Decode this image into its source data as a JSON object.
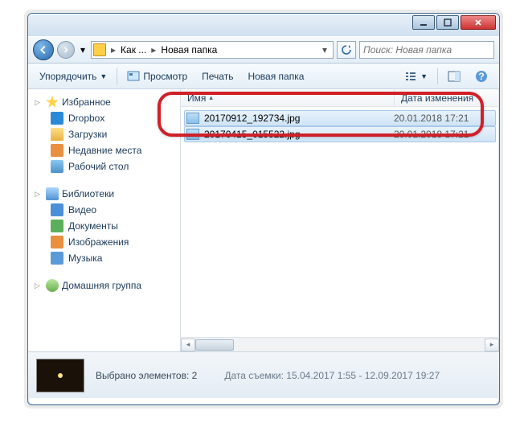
{
  "breadcrumb": {
    "seg1": "Как ...",
    "seg2": "Новая папка"
  },
  "search": {
    "placeholder": "Поиск: Новая папка"
  },
  "toolbar": {
    "organize": "Упорядочить",
    "preview": "Просмотр",
    "print": "Печать",
    "new_folder": "Новая папка"
  },
  "sidebar": {
    "favorites": {
      "label": "Избранное",
      "items": [
        "Dropbox",
        "Загрузки",
        "Недавние места",
        "Рабочий стол"
      ]
    },
    "libraries": {
      "label": "Библиотеки",
      "items": [
        "Видео",
        "Документы",
        "Изображения",
        "Музыка"
      ]
    },
    "homegroup": {
      "label": "Домашняя группа"
    }
  },
  "columns": {
    "name": "Имя",
    "date": "Дата изменения"
  },
  "files": [
    {
      "name": "20170912_192734.jpg",
      "date": "20.01.2018 17:21"
    },
    {
      "name": "20170415_015522.jpg",
      "date": "20.01.2018 17:21"
    }
  ],
  "status": {
    "selected": "Выбрано элементов: 2",
    "meta_label": "Дата съемки:",
    "meta_value": "15.04.2017 1:55 - 12.09.2017 19:27"
  }
}
